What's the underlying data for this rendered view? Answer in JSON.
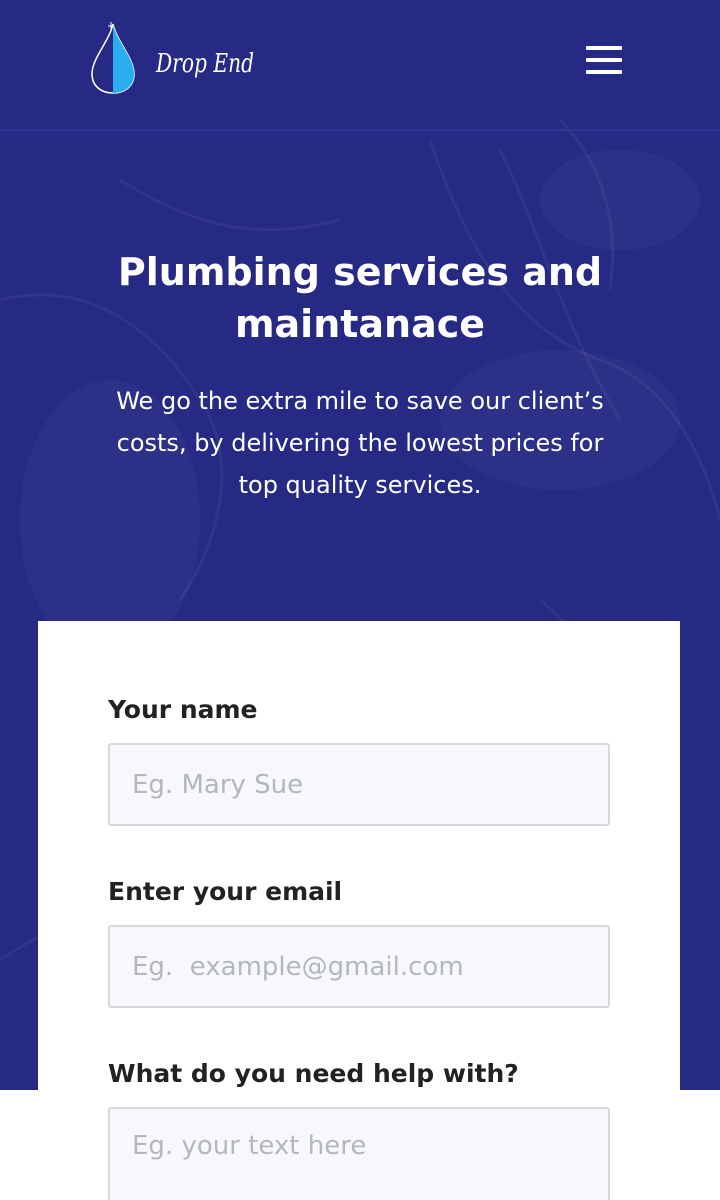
{
  "colors": {
    "hero_background": "#262a84",
    "logo_drop": "#29aef0",
    "text_on_hero": "#ffffff",
    "card_background": "#ffffff",
    "input_background": "#f7f8fc",
    "input_border": "#d6d8de",
    "placeholder": "#b4b6c0",
    "label": "#222222"
  },
  "header": {
    "logo_text": "Drop End",
    "menu_icon": "hamburger-menu-icon"
  },
  "hero": {
    "title_line1": "Plumbing services and",
    "title_line2": "maintanace",
    "subtitle_line1": "We go the extra mile to save our client’s",
    "subtitle_line2": "costs, by delivering the lowest prices for",
    "subtitle_line3": "top quality services."
  },
  "form": {
    "name": {
      "label": "Your name",
      "placeholder": "Eg. Mary Sue",
      "value": ""
    },
    "email": {
      "label": "Enter your email",
      "placeholder": "Eg.  example@gmail.com",
      "value": ""
    },
    "help": {
      "label": "What do you need help with?",
      "placeholder": "Eg. your text here",
      "value": ""
    }
  }
}
